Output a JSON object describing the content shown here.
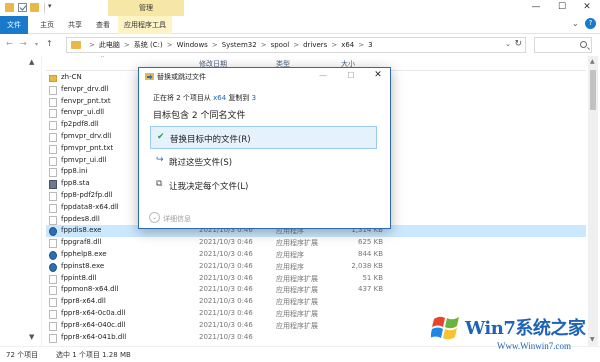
{
  "title_bar": {
    "contextual_tab": "管理",
    "window_controls": [
      "—",
      "☐",
      "✕"
    ]
  },
  "ribbon": {
    "file_tab": "文件",
    "tabs": [
      "主页",
      "共享",
      "查看"
    ],
    "contextual_tab": "应用程序工具",
    "help_label": "?"
  },
  "address_bar": {
    "breadcrumbs": [
      "此电脑",
      "系统 (C:)",
      "Windows",
      "System32",
      "spool",
      "drivers",
      "x64",
      "3"
    ],
    "separator": ">"
  },
  "file_list": {
    "columns": {
      "date": "修改日期",
      "type": "类型",
      "size": "大小"
    },
    "rows": [
      {
        "name": "zh-CN",
        "icon": "folder",
        "date": "",
        "type": "",
        "size": ""
      },
      {
        "name": "fenvpr_drv.dll",
        "icon": "file",
        "date": "",
        "type": "",
        "size": ""
      },
      {
        "name": "fenvpr_pnt.txt",
        "icon": "file",
        "date": "",
        "type": "",
        "size": ""
      },
      {
        "name": "fenvpr_ui.dll",
        "icon": "file",
        "date": "",
        "type": "",
        "size": ""
      },
      {
        "name": "fp2pdf8.dll",
        "icon": "file",
        "date": "",
        "type": "",
        "size": ""
      },
      {
        "name": "fpmvpr_drv.dll",
        "icon": "file",
        "date": "",
        "type": "",
        "size": ""
      },
      {
        "name": "fpmvpr_pnt.txt",
        "icon": "file",
        "date": "",
        "type": "",
        "size": ""
      },
      {
        "name": "fpmvpr_ui.dll",
        "icon": "file",
        "date": "",
        "type": "",
        "size": ""
      },
      {
        "name": "fpp8.ini",
        "icon": "file",
        "date": "",
        "type": "",
        "size": ""
      },
      {
        "name": "fpp8.sta",
        "icon": "sta",
        "date": "",
        "type": "",
        "size": ""
      },
      {
        "name": "fpp8-pdf2fp.dll",
        "icon": "file",
        "date": "",
        "type": "",
        "size": ""
      },
      {
        "name": "fppdata8-x64.dll",
        "icon": "file",
        "date": "",
        "type": "",
        "size": ""
      },
      {
        "name": "fppdes8.dll",
        "icon": "file",
        "date": "",
        "type": "",
        "size": ""
      },
      {
        "name": "fppdis8.exe",
        "icon": "exe",
        "date": "2021/10/3 0:46",
        "type": "应用程序",
        "size": "1,314 KB",
        "selected": true
      },
      {
        "name": "fppgraf8.dll",
        "icon": "file",
        "date": "2021/10/3 0:46",
        "type": "应用程序扩展",
        "size": "625 KB"
      },
      {
        "name": "fpphelp8.exe",
        "icon": "exe",
        "date": "2021/10/3 0:46",
        "type": "应用程序",
        "size": "844 KB"
      },
      {
        "name": "fppinst8.exe",
        "icon": "exe",
        "date": "2021/10/3 0:46",
        "type": "应用程序",
        "size": "2,038 KB"
      },
      {
        "name": "fppint8.dll",
        "icon": "file",
        "date": "2021/10/3 0:46",
        "type": "应用程序扩展",
        "size": "51 KB"
      },
      {
        "name": "fppmon8-x64.dll",
        "icon": "file",
        "date": "2021/10/3 0:46",
        "type": "应用程序扩展",
        "size": "437 KB"
      },
      {
        "name": "fppr8-x64.dll",
        "icon": "file",
        "date": "2021/10/3 0:46",
        "type": "应用程序扩展",
        "size": ""
      },
      {
        "name": "fppr8-x64-0c0a.dll",
        "icon": "file",
        "date": "2021/10/3 0:46",
        "type": "应用程序扩展",
        "size": ""
      },
      {
        "name": "fppr8-x64-040c.dll",
        "icon": "file",
        "date": "2021/10/3 0:46",
        "type": "应用程序扩展",
        "size": ""
      },
      {
        "name": "fppr8-x64-041b.dll",
        "icon": "file",
        "date": "2021/10/3 0:46",
        "type": "",
        "size": ""
      }
    ]
  },
  "status_bar": {
    "item_count": "72 个项目",
    "selection": "选中 1 个项目  1.28 MB"
  },
  "dialog": {
    "title": "替换或跳过文件",
    "progress_prefix": "正在将 2 个项目从",
    "progress_source": "x64",
    "progress_middle": "复制到",
    "progress_dest": "3",
    "heading": "目标包含 2 个同名文件",
    "options": [
      {
        "label": "替换目标中的文件(R)",
        "icon": "check-icon"
      },
      {
        "label": "跳过这些文件(S)",
        "icon": "skip-icon"
      },
      {
        "label": "让我决定每个文件(L)",
        "icon": "compare-icon"
      }
    ],
    "details_label": "详细信息",
    "controls": [
      "—",
      "☐",
      "✕"
    ]
  },
  "watermark": {
    "brand": "Win7系统之家",
    "url": "Www.Winwin7.com"
  },
  "colors": {
    "accent": "#1979ca",
    "selection": "#cce8ff",
    "dialog_border": "#2b6cb0",
    "option_highlight": "#e5f1fb",
    "folder": "#e8b84a",
    "watermark": "#1e63b8"
  }
}
